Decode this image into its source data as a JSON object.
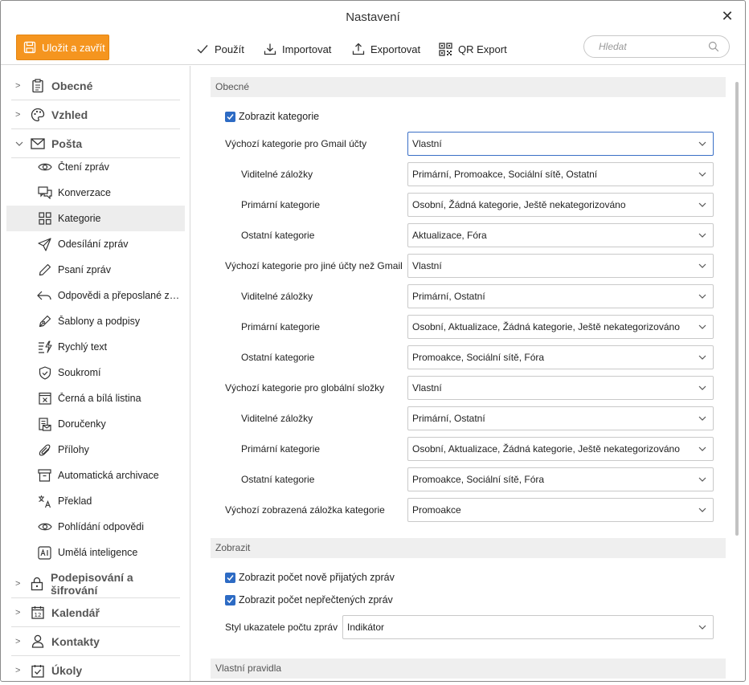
{
  "window": {
    "title": "Nastavení"
  },
  "toolbar": {
    "save_label": "Uložit a zavřít",
    "apply_label": "Použít",
    "import_label": "Importovat",
    "export_label": "Exportovat",
    "qr_label": "QR Export",
    "search_placeholder": "Hledat"
  },
  "sidebar": {
    "groups": [
      {
        "label": "Obecné",
        "icon": "clipboard-icon"
      },
      {
        "label": "Vzhled",
        "icon": "palette-icon"
      },
      {
        "label": "Pošta",
        "icon": "envelope-icon"
      },
      {
        "label": "Podepisování a šifrování",
        "icon": "lock-icon"
      },
      {
        "label": "Kalendář",
        "icon": "calendar-icon"
      },
      {
        "label": "Kontakty",
        "icon": "person-icon"
      },
      {
        "label": "Úkoly",
        "icon": "checklist-icon"
      }
    ],
    "mail_items": [
      {
        "label": "Čtení zpráv",
        "icon": "eye-icon"
      },
      {
        "label": "Konverzace",
        "icon": "chat-icon"
      },
      {
        "label": "Kategorie",
        "icon": "grid-icon",
        "active": true
      },
      {
        "label": "Odesílání zpráv",
        "icon": "send-icon"
      },
      {
        "label": "Psaní zpráv",
        "icon": "pencil-icon"
      },
      {
        "label": "Odpovědi a přeposlané zpr...",
        "icon": "reply-icon"
      },
      {
        "label": "Šablony a podpisy",
        "icon": "pen-nib-icon"
      },
      {
        "label": "Rychlý text",
        "icon": "quick-text-icon"
      },
      {
        "label": "Soukromí",
        "icon": "shield-icon"
      },
      {
        "label": "Černá a bílá listina",
        "icon": "blacklist-icon"
      },
      {
        "label": "Doručenky",
        "icon": "receipt-icon"
      },
      {
        "label": "Přílohy",
        "icon": "paperclip-icon"
      },
      {
        "label": "Automatická archivace",
        "icon": "archive-icon"
      },
      {
        "label": "Překlad",
        "icon": "translate-icon"
      },
      {
        "label": "Pohlídání odpovědi",
        "icon": "eye-watch-icon"
      },
      {
        "label": "Umělá inteligence",
        "icon": "ai-icon"
      }
    ]
  },
  "content": {
    "section_general": "Obecné",
    "show_categories": "Zobrazit kategorie",
    "rows": [
      {
        "label": "Výchozí kategorie pro Gmail účty",
        "value": "Vlastní",
        "indent": false
      },
      {
        "label": "Viditelné záložky",
        "value": "Primární, Promoakce, Sociální sítě, Ostatní",
        "indent": true
      },
      {
        "label": "Primární kategorie",
        "value": "Osobní, Žádná kategorie, Ještě nekategorizováno",
        "indent": true
      },
      {
        "label": "Ostatní kategorie",
        "value": "Aktualizace, Fóra",
        "indent": true
      },
      {
        "label": "Výchozí kategorie pro jiné účty než Gmail",
        "value": "Vlastní",
        "indent": false
      },
      {
        "label": "Viditelné záložky",
        "value": "Primární, Ostatní",
        "indent": true
      },
      {
        "label": "Primární kategorie",
        "value": "Osobní, Aktualizace, Žádná kategorie, Ještě nekategorizováno",
        "indent": true
      },
      {
        "label": "Ostatní kategorie",
        "value": "Promoakce, Sociální sítě, Fóra",
        "indent": true
      },
      {
        "label": "Výchozí kategorie pro globální složky",
        "value": "Vlastní",
        "indent": false
      },
      {
        "label": "Viditelné záložky",
        "value": "Primární, Ostatní",
        "indent": true
      },
      {
        "label": "Primární kategorie",
        "value": "Osobní, Aktualizace, Žádná kategorie, Ještě nekategorizováno",
        "indent": true
      },
      {
        "label": "Ostatní kategorie",
        "value": "Promoakce, Sociální sítě, Fóra",
        "indent": true
      },
      {
        "label": "Výchozí zobrazená záložka kategorie",
        "value": "Promoakce",
        "indent": false
      }
    ],
    "section_display": "Zobrazit",
    "show_new_count": "Zobrazit počet nově přijatých zpráv",
    "show_unread_count": "Zobrazit počet nepřečtených zpráv",
    "indicator_label": "Styl ukazatele počtu zpráv",
    "indicator_value": "Indikátor",
    "section_rules": "Vlastní pravidla"
  },
  "colors": {
    "accent": "#f5951f",
    "checkbox": "#2d6bc4",
    "focus": "#3a6fc6"
  }
}
